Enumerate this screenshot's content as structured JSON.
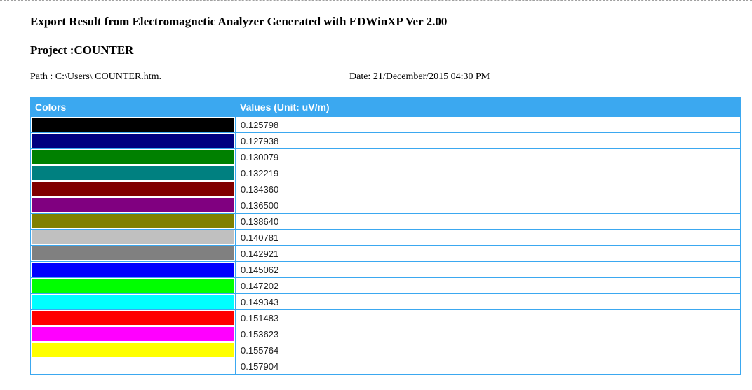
{
  "header": {
    "title": "Export Result from Electromagnetic Analyzer Generated with EDWinXP Ver 2.00",
    "project": "Project :COUNTER",
    "path": "Path : C:\\Users\\ COUNTER.htm.",
    "date": "Date: 21/December/2015 04:30 PM"
  },
  "table": {
    "headers": [
      "Colors",
      "Values (Unit: uV/m)"
    ],
    "rows": [
      {
        "color": "#000000",
        "value": "0.125798"
      },
      {
        "color": "#000080",
        "value": "0.127938"
      },
      {
        "color": "#008000",
        "value": "0.130079"
      },
      {
        "color": "#008080",
        "value": "0.132219"
      },
      {
        "color": "#800000",
        "value": "0.134360"
      },
      {
        "color": "#800080",
        "value": "0.136500"
      },
      {
        "color": "#808000",
        "value": "0.138640"
      },
      {
        "color": "#c0c0c0",
        "value": "0.140781"
      },
      {
        "color": "#808080",
        "value": "0.142921"
      },
      {
        "color": "#0000ff",
        "value": "0.145062"
      },
      {
        "color": "#00ff00",
        "value": "0.147202"
      },
      {
        "color": "#00ffff",
        "value": "0.149343"
      },
      {
        "color": "#ff0000",
        "value": "0.151483"
      },
      {
        "color": "#ff00ff",
        "value": "0.153623"
      },
      {
        "color": "#ffff00",
        "value": "0.155764"
      },
      {
        "color": "#ffffff",
        "value": "0.157904"
      }
    ]
  }
}
